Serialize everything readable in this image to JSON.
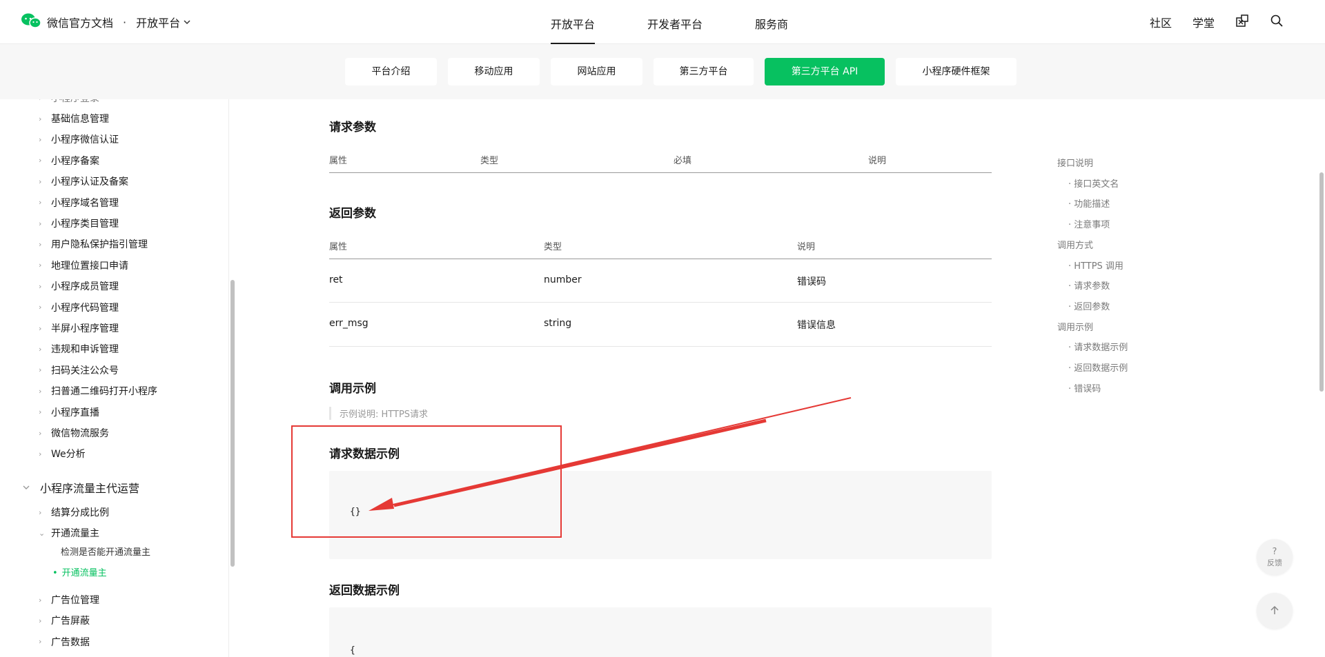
{
  "header": {
    "brand": "微信官方文档",
    "separator": "·",
    "platform": "开放平台",
    "nav": [
      "开放平台",
      "开发者平台",
      "服务商"
    ],
    "right": [
      "社区",
      "学堂"
    ]
  },
  "subtabs": [
    "平台介绍",
    "移动应用",
    "网站应用",
    "第三方平台",
    "第三方平台 API",
    "小程序硬件框架"
  ],
  "sidebar": {
    "items_top": [
      "基础信息管理",
      "小程序微信认证",
      "小程序备案",
      "小程序认证及备案",
      "小程序域名管理",
      "小程序类目管理",
      "用户隐私保护指引管理",
      "地理位置接口申请",
      "小程序成员管理",
      "小程序代码管理",
      "半屏小程序管理",
      "违规和申诉管理",
      "扫码关注公众号",
      "扫普通二维码打开小程序",
      "小程序直播",
      "微信物流服务",
      "We分析"
    ],
    "group": "小程序流量主代运营",
    "group_items": [
      "结算分成比例",
      "开通流量主"
    ],
    "sub_items": [
      "检测是否能开通流量主",
      "开通流量主"
    ],
    "items_bottom": [
      "广告位管理",
      "广告屏蔽",
      "广告数据"
    ]
  },
  "content": {
    "req_title": "请求参数",
    "req_headers": [
      "属性",
      "类型",
      "必填",
      "说明"
    ],
    "resp_title": "返回参数",
    "resp_headers": [
      "属性",
      "类型",
      "说明"
    ],
    "resp_rows": [
      {
        "name": "ret",
        "type": "number",
        "desc": "错误码"
      },
      {
        "name": "err_msg",
        "type": "string",
        "desc": "错误信息"
      }
    ],
    "example_title": "调用示例",
    "example_note": "示例说明: HTTPS请求",
    "req_example_title": "请求数据示例",
    "req_example_code": "{}",
    "resp_example_title": "返回数据示例",
    "resp_example_code": "{"
  },
  "toc": {
    "entries": [
      {
        "level": 1,
        "label": "接口说明"
      },
      {
        "level": 2,
        "label": "· 接口英文名"
      },
      {
        "level": 2,
        "label": "· 功能描述"
      },
      {
        "level": 2,
        "label": "· 注意事项"
      },
      {
        "level": 1,
        "label": "调用方式"
      },
      {
        "level": 2,
        "label": "· HTTPS 调用"
      },
      {
        "level": 2,
        "label": "· 请求参数"
      },
      {
        "level": 2,
        "label": "· 返回参数"
      },
      {
        "level": 1,
        "label": "调用示例"
      },
      {
        "level": 2,
        "label": "· 请求数据示例"
      },
      {
        "level": 2,
        "label": "· 返回数据示例"
      },
      {
        "level": 2,
        "label": "· 错误码"
      }
    ]
  },
  "fab": {
    "feedback_label": "反馈",
    "feedback_icon": "?"
  },
  "colors": {
    "accent": "#07c160",
    "annotation": "#e53935"
  }
}
